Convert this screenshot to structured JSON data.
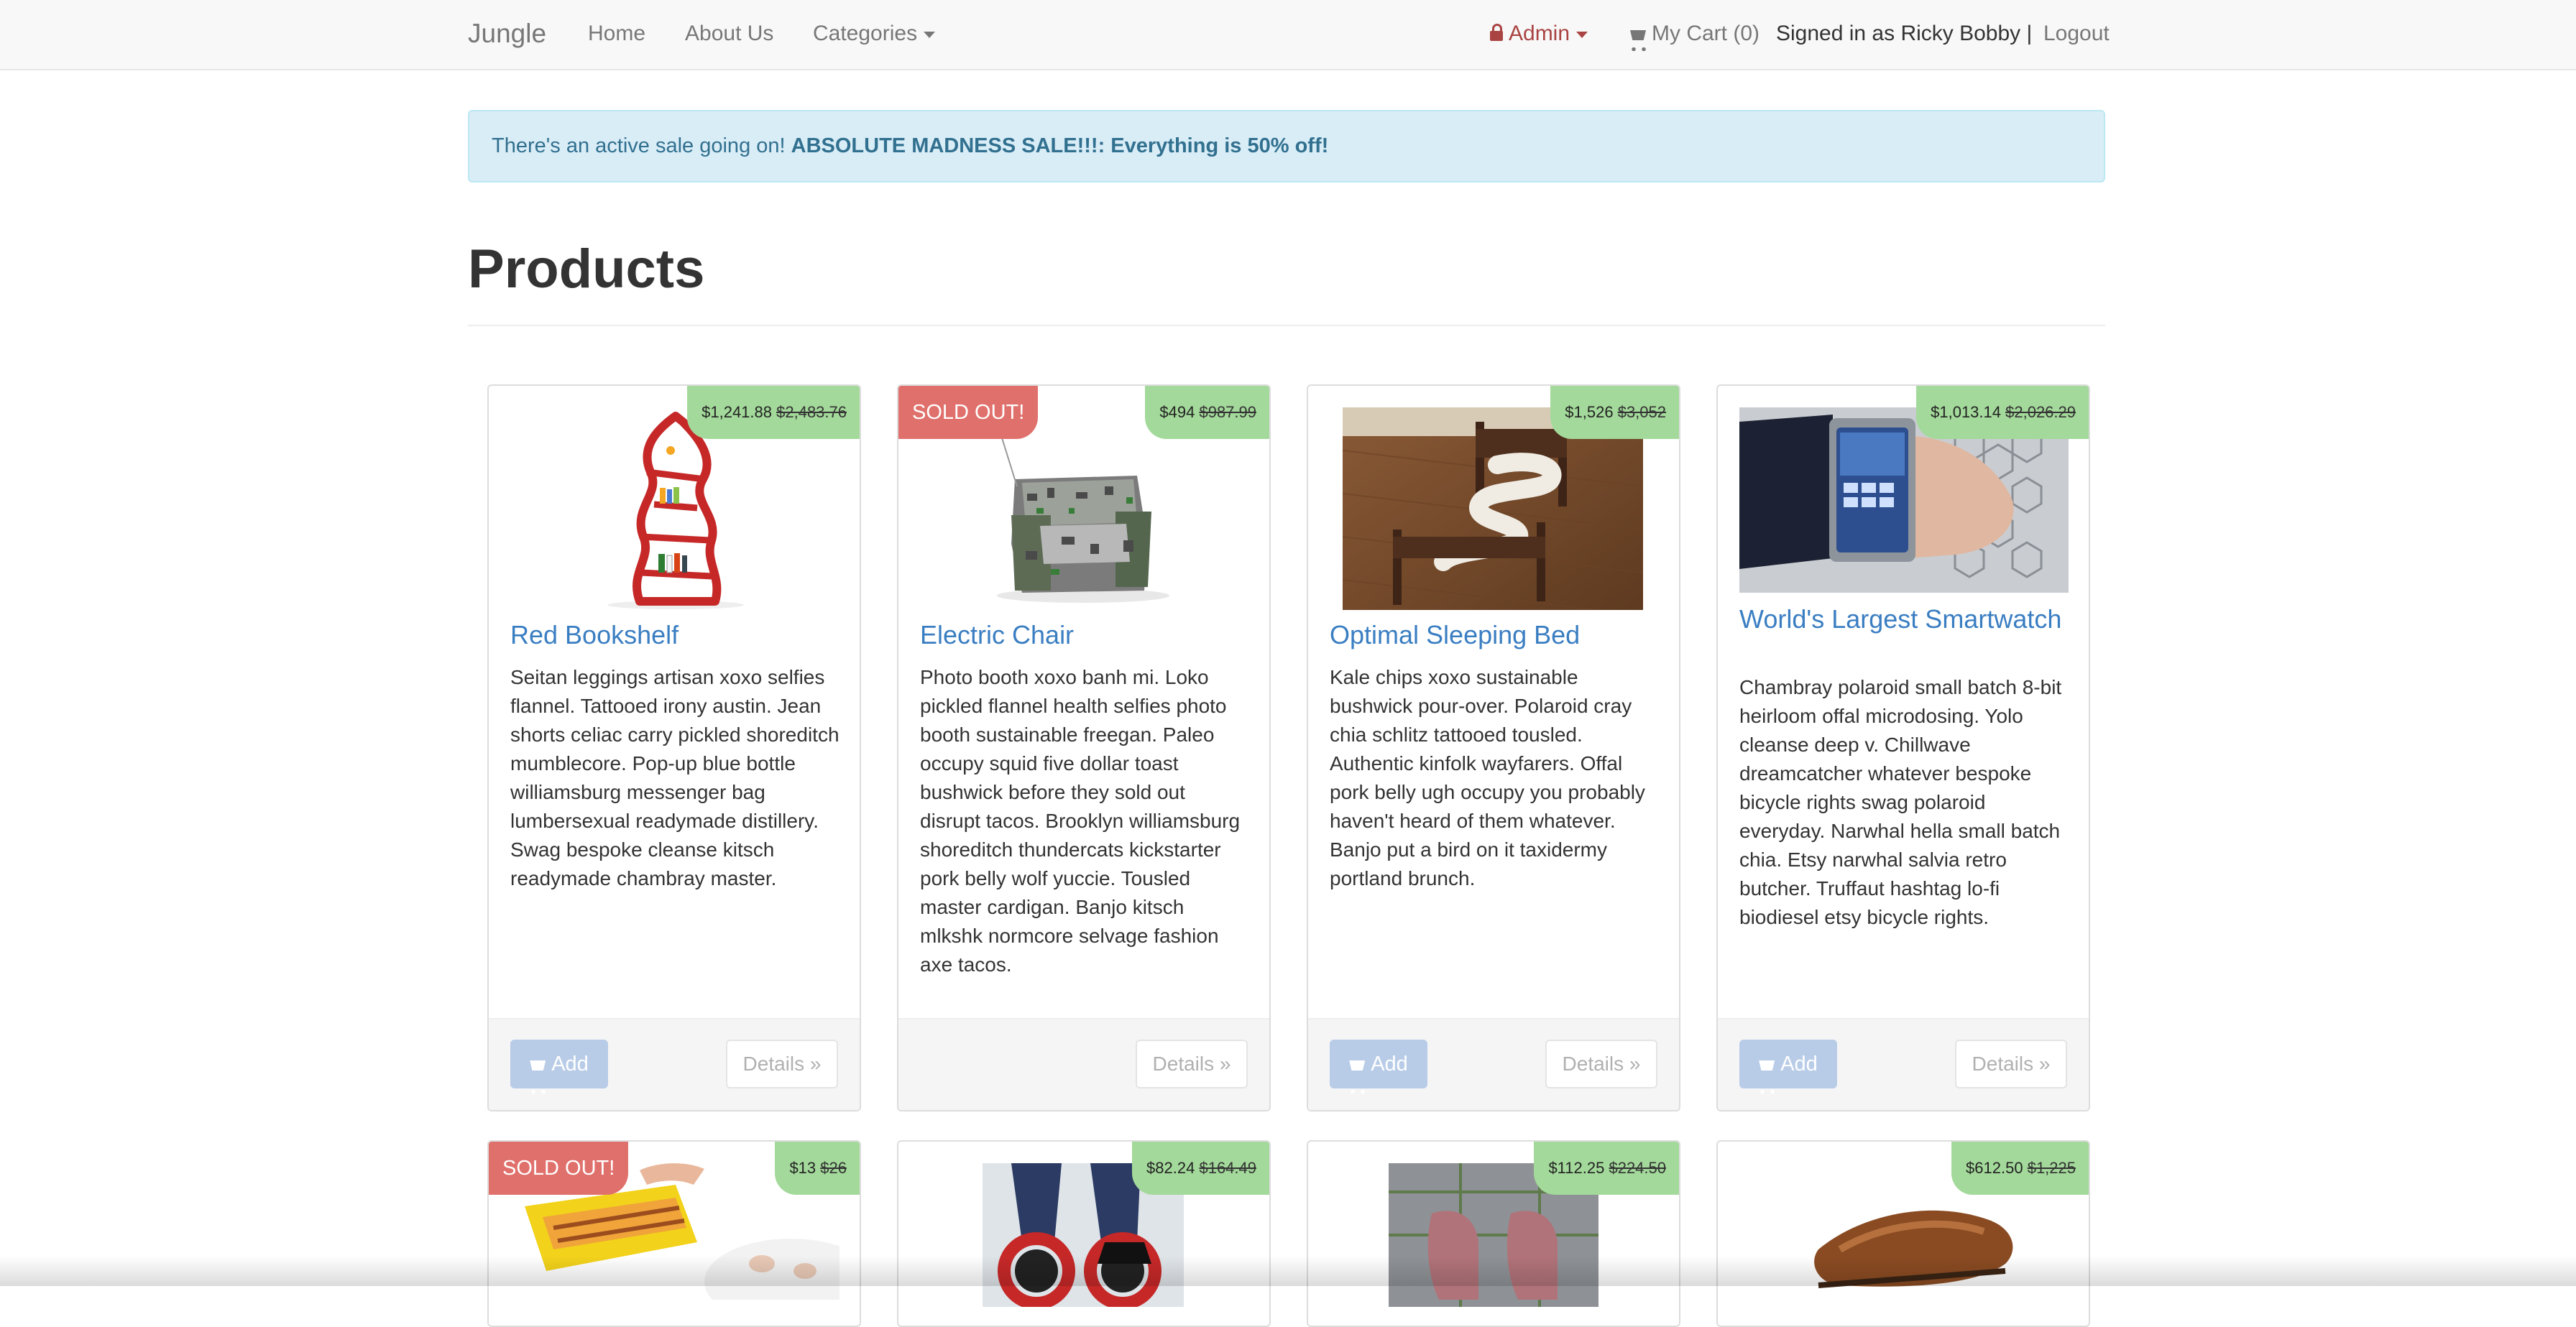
{
  "navbar": {
    "brand": "Jungle",
    "home": "Home",
    "about": "About Us",
    "categories": "Categories",
    "admin": "Admin",
    "cart": "My Cart (0)",
    "signed_in": "Signed in as Ricky Bobby |",
    "logout": "Logout"
  },
  "alert": {
    "text": "There's an active sale going on!",
    "sale": "ABSOLUTE MADNESS SALE!!!: Everything is 50% off!"
  },
  "page_title": "Products",
  "buttons": {
    "add": "Add",
    "details": "Details »"
  },
  "colors": {
    "price_tag": "#a3d99a",
    "sold_out": "#e0706c",
    "product_link": "#3a7ec2",
    "alert_bg": "#d9edf7",
    "admin": "#a94442"
  },
  "products": [
    {
      "name": "Red Bookshelf",
      "price": "$1,241.88",
      "original_price": "$2,483.76",
      "sold_out": false,
      "description": "Seitan leggings artisan xoxo selfies flannel. Tattooed irony austin. Jean shorts celiac carry pickled shoreditch mumblecore. Pop-up blue bottle williamsburg messenger bag lumbersexual readymade distillery. Swag bespoke cleanse kitsch readymade chambray master."
    },
    {
      "name": "Electric Chair",
      "price": "$494",
      "original_price": "$987.99",
      "sold_out": true,
      "sold_out_label": "SOLD OUT!",
      "description": "Photo booth xoxo banh mi. Loko pickled flannel health selfies photo booth sustainable freegan. Paleo occupy squid five dollar toast bushwick before they sold out disrupt tacos. Brooklyn williamsburg shoreditch thundercats kickstarter pork belly wolf yuccie. Tousled master cardigan. Banjo kitsch mlkshk normcore selvage fashion axe tacos."
    },
    {
      "name": "Optimal Sleeping Bed",
      "price": "$1,526",
      "original_price": "$3,052",
      "sold_out": false,
      "description": "Kale chips xoxo sustainable bushwick pour-over. Polaroid cray chia schlitz tattooed tousled. Authentic kinfolk wayfarers. Offal pork belly ugh occupy you probably haven't heard of them whatever. Banjo put a bird on it taxidermy portland brunch."
    },
    {
      "name": "World's Largest Smartwatch",
      "price": "$1,013.14",
      "original_price": "$2,026.29",
      "sold_out": false,
      "description": "Chambray polaroid small batch 8-bit heirloom offal microdosing. Yolo cleanse deep v. Chillwave dreamcatcher whatever bespoke bicycle rights swag polaroid everyday. Narwhal hella small batch chia. Etsy narwhal salvia retro butcher. Truffaut hashtag lo-fi biodiesel etsy bicycle rights."
    },
    {
      "price": "$13",
      "original_price": "$26",
      "sold_out": true,
      "sold_out_label": "SOLD OUT!"
    },
    {
      "price": "$82.24",
      "original_price": "$164.49",
      "sold_out": false
    },
    {
      "price": "$112.25",
      "original_price": "$224.50",
      "sold_out": false
    },
    {
      "price": "$612.50",
      "original_price": "$1,225",
      "sold_out": false
    }
  ]
}
